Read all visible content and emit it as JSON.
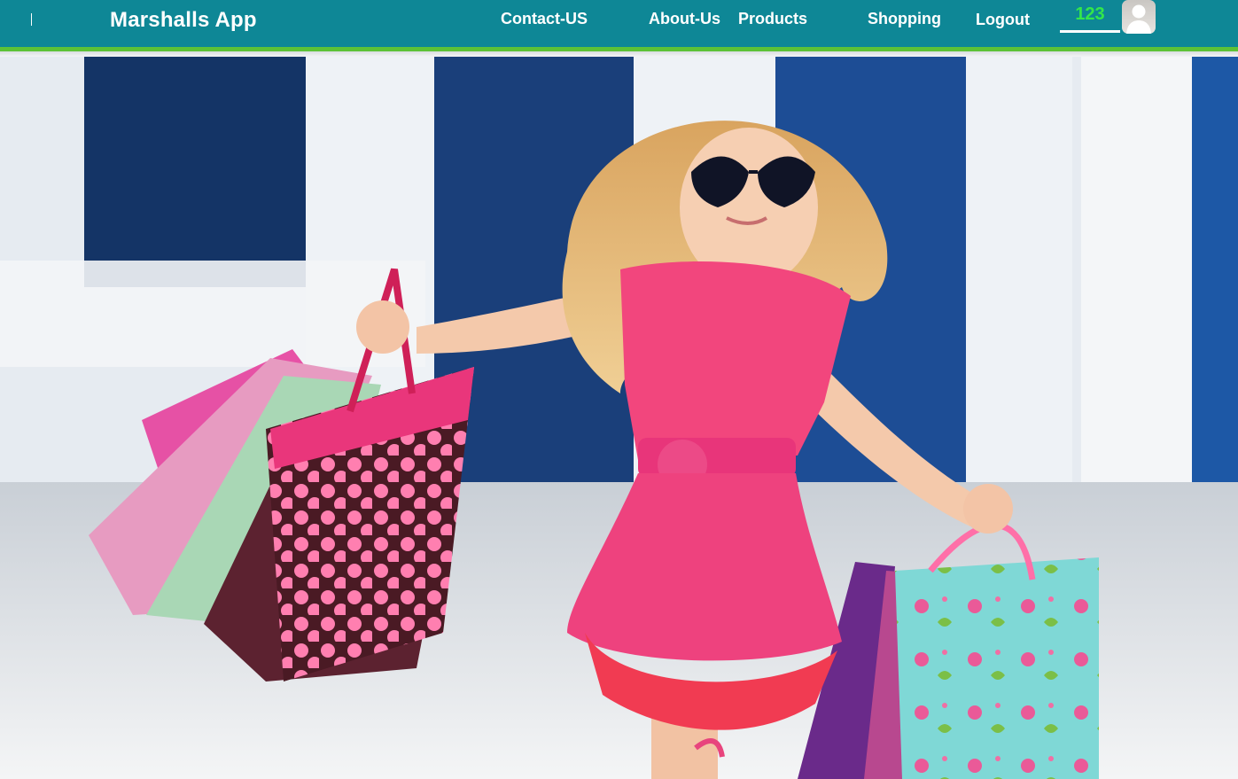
{
  "navbar": {
    "brand": "Marshalls App",
    "links": [
      "Contact-US",
      "About-Us",
      "Products",
      "Shopping",
      "Logout"
    ],
    "user_count": "123",
    "avatar_icon": "user-avatar-icon"
  },
  "hero": {
    "image_icon": "girl-shopping-bags-photo"
  },
  "colors": {
    "navbar": "#0e8796",
    "accent_line": "#5cc236",
    "count_text": "#33e74a"
  }
}
